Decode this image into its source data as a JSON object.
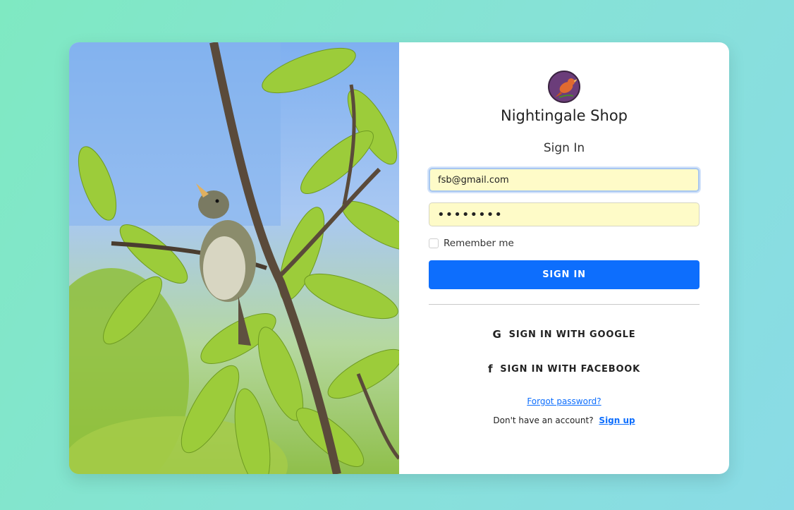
{
  "brand": {
    "name": "Nightingale Shop",
    "logo_icon": "nightingale-bird-icon"
  },
  "form": {
    "title": "Sign In",
    "email_value": "fsb@gmail.com",
    "password_value": "••••••••",
    "remember_label": "Remember me",
    "remember_checked": false,
    "signin_label": "SIGN IN",
    "google_label": "SIGN IN WITH GOOGLE",
    "google_icon": "google-icon",
    "facebook_label": "SIGN IN WITH FACEBOOK",
    "facebook_icon": "facebook-icon",
    "forgot_label": "Forgot password?",
    "no_account_text": "Don't have an account?",
    "signup_label": "Sign up"
  },
  "colors": {
    "primary": "#0d6efd",
    "autofill_bg": "#fefbc8",
    "bg_gradient_start": "#7fe9c2",
    "bg_gradient_end": "#8adbe6"
  }
}
